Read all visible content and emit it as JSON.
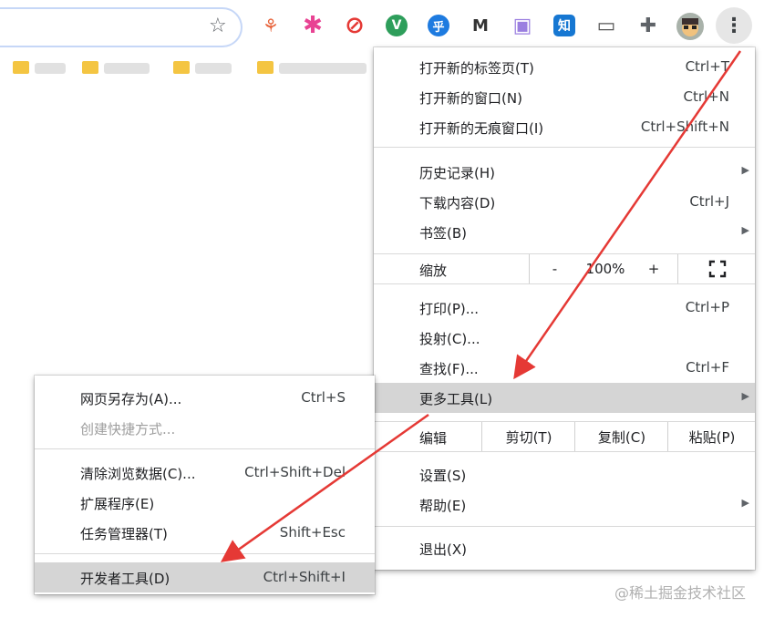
{
  "menu": {
    "new_tab": {
      "label": "打开新的标签页(T)",
      "shortcut": "Ctrl+T"
    },
    "new_window": {
      "label": "打开新的窗口(N)",
      "shortcut": "Ctrl+N"
    },
    "new_incognito": {
      "label": "打开新的无痕窗口(I)",
      "shortcut": "Ctrl+Shift+N"
    },
    "history": {
      "label": "历史记录(H)"
    },
    "downloads": {
      "label": "下载内容(D)",
      "shortcut": "Ctrl+J"
    },
    "bookmarks": {
      "label": "书签(B)"
    },
    "zoom": {
      "label": "缩放",
      "minus": "-",
      "value": "100%",
      "plus": "+"
    },
    "print": {
      "label": "打印(P)...",
      "shortcut": "Ctrl+P"
    },
    "cast": {
      "label": "投射(C)..."
    },
    "find": {
      "label": "查找(F)...",
      "shortcut": "Ctrl+F"
    },
    "more_tools": {
      "label": "更多工具(L)"
    },
    "edit": {
      "label": "编辑",
      "cut": "剪切(T)",
      "copy": "复制(C)",
      "paste": "粘贴(P)"
    },
    "settings": {
      "label": "设置(S)"
    },
    "help": {
      "label": "帮助(E)"
    },
    "exit": {
      "label": "退出(X)"
    }
  },
  "submenu": {
    "save_page": {
      "label": "网页另存为(A)...",
      "shortcut": "Ctrl+S"
    },
    "create_shortcut": {
      "label": "创建快捷方式..."
    },
    "clear_data": {
      "label": "清除浏览数据(C)...",
      "shortcut": "Ctrl+Shift+Del"
    },
    "extensions": {
      "label": "扩展程序(E)"
    },
    "task_manager": {
      "label": "任务管理器(T)",
      "shortcut": "Shift+Esc"
    },
    "devtools": {
      "label": "开发者工具(D)",
      "shortcut": "Ctrl+Shift+I"
    }
  },
  "toolbar": {
    "star_glyph": "☆",
    "kebab_glyph": "⋮",
    "extensions": [
      {
        "name": "sitemap-extension-icon",
        "glyph": "⚘",
        "color": "#e8643c"
      },
      {
        "name": "pinwheel-extension-icon",
        "glyph": "✱",
        "color": "#e84393"
      },
      {
        "name": "block-extension-icon",
        "glyph": "⊘",
        "color": "#e53935"
      },
      {
        "name": "vue-extension-icon",
        "glyph": "V",
        "color": "#2e9e5b"
      },
      {
        "name": "zhihu-hu-extension-icon",
        "glyph": "乎",
        "color": "#1e7be0"
      },
      {
        "name": "shield-extension-icon",
        "glyph": "M",
        "color": "#333333"
      },
      {
        "name": "screen-extension-icon",
        "glyph": "▣",
        "color": "#9b7fe0"
      },
      {
        "name": "zhihu-zhi-extension-icon",
        "glyph": "知",
        "color": "#1677d2"
      },
      {
        "name": "window-extension-icon",
        "glyph": "▭",
        "color": "#555555"
      },
      {
        "name": "puzzle-extension-icon",
        "glyph": "✚",
        "color": "#5f6368"
      }
    ]
  },
  "watermark": "@稀土掘金技术社区"
}
